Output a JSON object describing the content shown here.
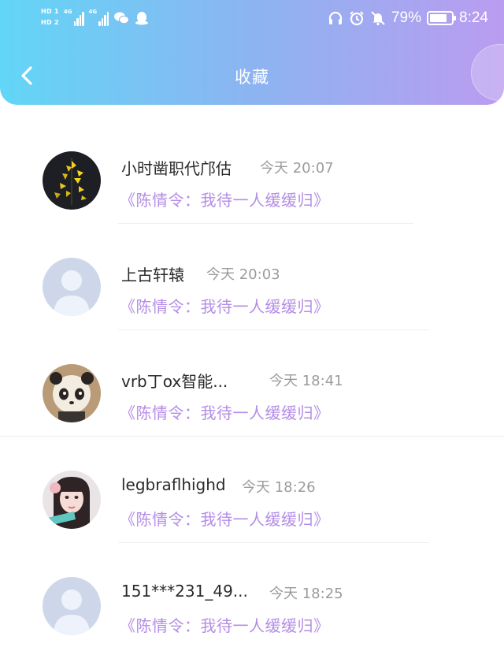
{
  "status_bar": {
    "hd1": "HD 1",
    "hd2": "HD 2",
    "net1": "4G",
    "net2": "4G",
    "battery_percent": "79%",
    "time": "8:24",
    "battery_level": 0.79
  },
  "header": {
    "title": "收藏",
    "back_icon": "chevron-left-icon"
  },
  "items": [
    {
      "name": "小时凿职代邝估",
      "time": "今天 20:07",
      "title": "《陈情令：我待一人缓缓归》",
      "avatar": "flower"
    },
    {
      "name": "上古轩辕",
      "time": "今天 20:03",
      "title": "《陈情令：我待一人缓缓归》",
      "avatar": "default"
    },
    {
      "name": "vrb丁ox智能...",
      "time": "今天 18:41",
      "title": "《陈情令：我待一人缓缓归》",
      "avatar": "panda"
    },
    {
      "name": "legbraflhighd",
      "time": "今天 18:26",
      "title": "《陈情令：我待一人缓缓归》",
      "avatar": "girl"
    },
    {
      "name": "151***231_49...",
      "time": "今天 18:25",
      "title": "《陈情令：我待一人缓缓归》",
      "avatar": "default"
    }
  ],
  "colors": {
    "header_gradient_start": "#62d6f6",
    "header_gradient_end": "#ba9cf0",
    "link_purple": "#b48de6",
    "time_gray": "#9b9b9b"
  }
}
